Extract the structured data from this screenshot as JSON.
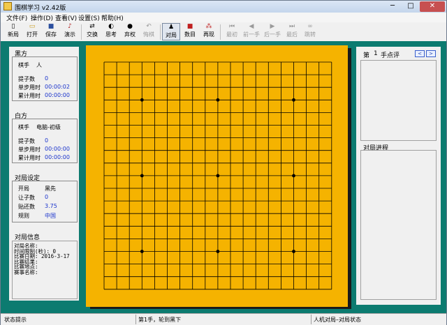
{
  "window": {
    "title": "围棋学习 v2.42版",
    "controls": {
      "minimize": "─",
      "maximize": "□",
      "close": "✕"
    }
  },
  "menu": [
    "文件(F)",
    "操作(D)",
    "查看(V)",
    "设置(S)",
    "帮助(H)"
  ],
  "toolbar": {
    "new": {
      "label": "新局",
      "icon": "new-file-icon"
    },
    "open": {
      "label": "打开",
      "icon": "open-folder-icon"
    },
    "save": {
      "label": "保存",
      "icon": "save-disk-icon"
    },
    "demo": {
      "label": "演示",
      "icon": "demo-icon"
    },
    "swap": {
      "label": "交换",
      "icon": "swap-icon"
    },
    "think": {
      "label": "思考",
      "icon": "think-icon"
    },
    "resign": {
      "label": "弃权",
      "icon": "resign-icon"
    },
    "undo": {
      "label": "悔棋",
      "icon": "undo-icon"
    },
    "game": {
      "label": "对局",
      "icon": "game-icon"
    },
    "count": {
      "label": "数目",
      "icon": "count-icon"
    },
    "replay": {
      "label": "再现",
      "icon": "replay-icon"
    },
    "first": {
      "label": "最初",
      "icon": "first-icon"
    },
    "prev": {
      "label": "前一手",
      "icon": "prev-icon"
    },
    "next": {
      "label": "后一手",
      "icon": "next-icon"
    },
    "last": {
      "label": "最后",
      "icon": "last-icon"
    },
    "jump": {
      "label": "跳转",
      "icon": "binoculars-icon"
    }
  },
  "black": {
    "title": "黑方",
    "player_label": "棋手",
    "player_value": "人",
    "captures_label": "提子数",
    "captures_value": "0",
    "step_time_label": "单步用时",
    "step_time_value": "00:00:02",
    "total_time_label": "累计用时",
    "total_time_value": "00:00:00"
  },
  "white": {
    "title": "白方",
    "player_label": "棋手",
    "player_value": "电脑-初级",
    "captures_label": "提子数",
    "captures_value": "0",
    "step_time_label": "单步用时",
    "step_time_value": "00:00:00",
    "total_time_label": "累计用时",
    "total_time_value": "00:00:00"
  },
  "settings": {
    "title": "对局设定",
    "opening_label": "开局",
    "opening_value": "黑先",
    "handicap_label": "让子数",
    "handicap_value": "0",
    "komi_label": "贴还数",
    "komi_value": "3.75",
    "rules_label": "规则",
    "rules_value": "中国"
  },
  "game_info": {
    "title": "对局信息",
    "lines": [
      "对局名称:",
      "时间限制(秒): 0",
      "比赛日期: 2016-3-17",
      "比赛结果:",
      "比赛地点:",
      "赛事名称:"
    ]
  },
  "board": {
    "size": 19,
    "star_points": [
      [
        3,
        3
      ],
      [
        3,
        9
      ],
      [
        3,
        15
      ],
      [
        9,
        3
      ],
      [
        9,
        9
      ],
      [
        9,
        15
      ],
      [
        15,
        3
      ],
      [
        15,
        9
      ],
      [
        15,
        15
      ]
    ]
  },
  "comment": {
    "move_prefix": "第",
    "move_number": "1",
    "move_suffix": "手点评",
    "prev_button": "<",
    "next_button": ">"
  },
  "progress": {
    "title": "对局进程"
  },
  "status": {
    "hint": "状态提示",
    "move": "第1手，轮到黑下",
    "mode": "人机对局–对局状态"
  },
  "colors": {
    "board": "#f5b300",
    "frame": "#0c7b70",
    "value_text": "#1a33cc"
  }
}
